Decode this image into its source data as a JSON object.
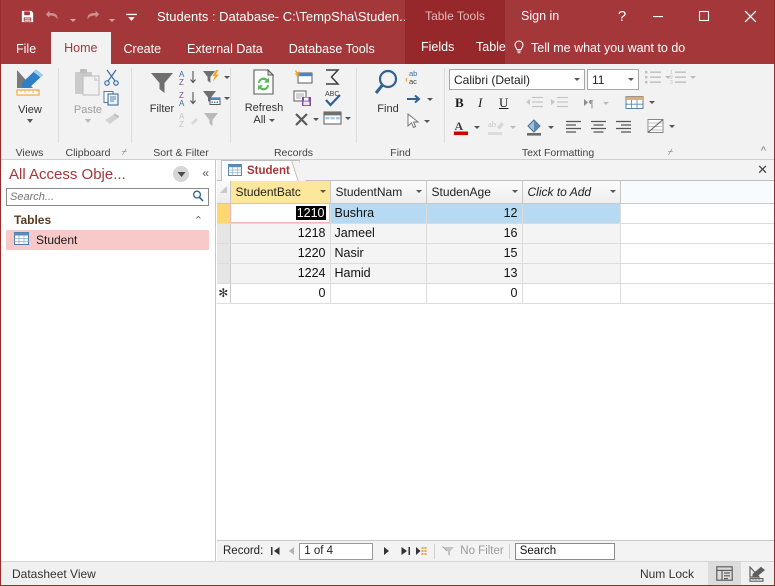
{
  "titlebar": {
    "save_icon": "save-icon",
    "undo_icon": "undo-icon",
    "redo_icon": "redo-icon",
    "customize_icon": "customize-qat-icon",
    "title": "Students : Database- C:\\TempSha\\Studen...",
    "context_tools": "Table Tools",
    "signin": "Sign in",
    "help": "?",
    "minimize": "—",
    "maximize": "☐",
    "close": "✕"
  },
  "ribbon_tabs": [
    {
      "label": "File",
      "active": false
    },
    {
      "label": "Home",
      "active": true
    },
    {
      "label": "Create",
      "active": false
    },
    {
      "label": "External Data",
      "active": false
    },
    {
      "label": "Database Tools",
      "active": false
    },
    {
      "label": "Fields",
      "active": false
    },
    {
      "label": "Table",
      "active": false
    }
  ],
  "tellme": {
    "label": "Tell me what you want to do",
    "icon": "lightbulb-icon"
  },
  "ribbon": {
    "groups": [
      {
        "name": "Views",
        "title": "Views"
      },
      {
        "name": "Clipboard",
        "title": "Clipboard"
      },
      {
        "name": "Sort & Filter",
        "title": "Sort & Filter"
      },
      {
        "name": "Records",
        "title": "Records"
      },
      {
        "name": "Find",
        "title": "Find"
      },
      {
        "name": "Text Formatting",
        "title": "Text Formatting"
      }
    ],
    "view_label": "View",
    "paste_label": "Paste",
    "cut_icon": "scissors-icon",
    "copy_icon": "copy-icon",
    "format_painter_icon": "format-painter-icon",
    "filter_label": "Filter",
    "sort_asc_icon": "sort-ascending-icon",
    "sort_desc_icon": "sort-descending-icon",
    "remove_sort_icon": "remove-sort-icon",
    "selection_icon": "selection-filter-icon",
    "advanced_icon": "advanced-filter-icon",
    "toggle_filter_icon": "toggle-filter-icon",
    "refresh_label_1": "Refresh",
    "refresh_label_2": "All",
    "new_record_icon": "new-record-icon",
    "save_record_icon": "save-record-icon",
    "delete_icon": "delete-record-icon",
    "totals_icon": "totals-sigma-icon",
    "spelling_icon": "spelling-abc-icon",
    "more_icon": "more-records-icon",
    "find_label": "Find",
    "replace_icon": "replace-ab-ac-icon",
    "goto_icon": "go-to-arrow-icon",
    "select_icon": "select-cursor-icon",
    "font_name": "Calibri (Detail)",
    "font_size": "11",
    "bold": "B",
    "italic": "I",
    "underline": "U",
    "bullets_icon": "bullets-icon",
    "numbering_icon": "numbering-icon",
    "dec_indent_icon": "decrease-indent-icon",
    "inc_indent_icon": "increase-indent-icon",
    "rtl_icon": "text-direction-icon",
    "gridlines_icon": "gridlines-icon",
    "font_color_icon": "font-color-icon",
    "highlight_icon": "text-highlight-icon",
    "fill_color_icon": "fill-color-icon",
    "align_left_icon": "align-left-icon",
    "align_center_icon": "align-center-icon",
    "align_right_icon": "align-right-icon",
    "alt_fill_icon": "alternate-row-color-icon",
    "collapse_ribbon_icon": "collapse-ribbon-icon"
  },
  "navpane": {
    "title": "All Access Obje...",
    "shutter_icon": "shutter-bar-dropdown-icon",
    "collapse_icon": "collapse-pane-icon",
    "search_placeholder": "Search...",
    "search_value": "",
    "search_icon": "search-icon",
    "group": {
      "label": "Tables",
      "chevron": "⌃"
    },
    "items": [
      {
        "label": "Student",
        "icon": "table-icon",
        "selected": true
      }
    ]
  },
  "doctab": {
    "label": "Student",
    "icon": "table-icon",
    "close": "✕"
  },
  "datasheet": {
    "columns": [
      {
        "header": "StudentBatc",
        "selected": true,
        "align": "num"
      },
      {
        "header": "StudentNam",
        "selected": false,
        "align": "text"
      },
      {
        "header": "StudenAge",
        "selected": false,
        "align": "num"
      },
      {
        "header": "Click to Add",
        "selected": false,
        "align": "add"
      }
    ],
    "rows": [
      {
        "sel": "",
        "current": true,
        "cells": [
          "1210",
          "Bushra",
          "12",
          ""
        ]
      },
      {
        "sel": "",
        "current": false,
        "cells": [
          "1218",
          "Jameel",
          "16",
          ""
        ]
      },
      {
        "sel": "",
        "current": false,
        "cells": [
          "1220",
          "Nasir",
          "15",
          ""
        ]
      },
      {
        "sel": "",
        "current": false,
        "cells": [
          "1224",
          "Hamid",
          "13",
          ""
        ]
      },
      {
        "sel": "✻",
        "current": false,
        "new": true,
        "cells": [
          "0",
          "",
          "0",
          ""
        ]
      }
    ],
    "active_cell_text": "1210"
  },
  "recordnav": {
    "label": "Record:",
    "first_icon": "first-record-icon",
    "prev_icon": "previous-record-icon",
    "position": "1 of 4",
    "next_icon": "next-record-icon",
    "last_icon": "last-record-icon",
    "new_icon": "new-record-icon",
    "filter_icon": "filter-indicator-icon",
    "filter_label": "No Filter",
    "search_value": "Search"
  },
  "statusbar": {
    "view": "Datasheet View",
    "numlock": "Num Lock",
    "datasheet_view_icon": "datasheet-view-icon",
    "design_view_icon": "design-view-icon"
  },
  "colors": {
    "accent": "#a4373a",
    "context": "#96282c",
    "selection": "#b6d9f4",
    "header_selected": "#fde79a",
    "nav_selected": "#f7c9c9"
  }
}
